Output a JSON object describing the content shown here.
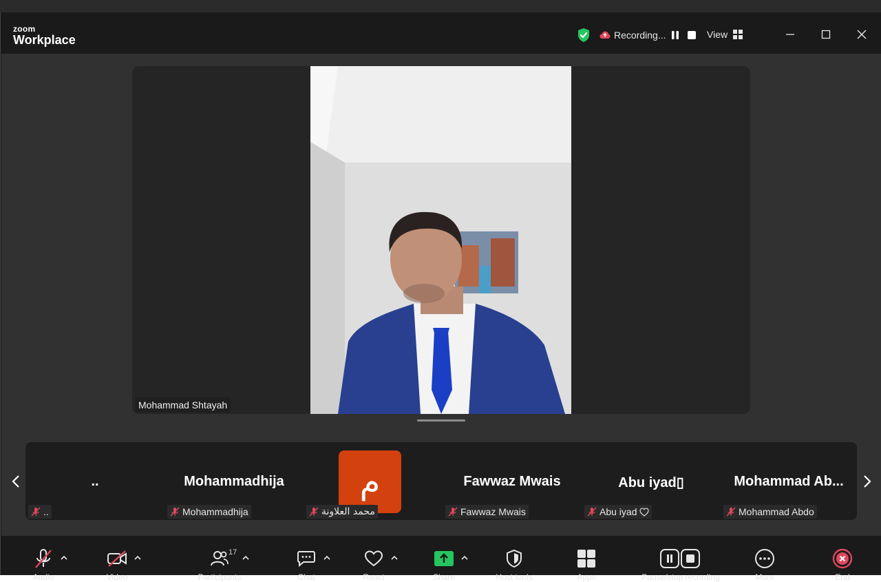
{
  "app": {
    "brand_top": "zoom",
    "brand_bottom": "Workplace"
  },
  "titlebar": {
    "recording_label": "Recording...",
    "view_label": "View"
  },
  "main_video": {
    "participant_name": "Mohammad Shtayah"
  },
  "gallery": {
    "tiles": [
      {
        "display": "..",
        "tag": ".."
      },
      {
        "display": "Mohammadhija",
        "tag": "Mohammadhija"
      },
      {
        "avatar_letter": "م",
        "tag": "محمد العلاونة"
      },
      {
        "display": "Fawwaz Mwais",
        "tag": "Fawwaz Mwais"
      },
      {
        "display": "Abu iyad▯",
        "tag": "Abu iyad"
      },
      {
        "display": "Mohammad Ab...",
        "tag": "Mohammad Abdo"
      }
    ]
  },
  "toolbar": {
    "audio_label": "Audio",
    "video_label": "Video",
    "participants_label": "Participants",
    "participants_count": "17",
    "chat_label": "Chat",
    "react_label": "React",
    "share_label": "Share",
    "host_tools_label": "Host tools",
    "view_label": "Apps",
    "recording_label": "Pause/stop recording",
    "more_label": "More",
    "end_label": "End"
  },
  "colors": {
    "accent_green": "#23c65f",
    "muted_red": "#e0475c",
    "avatar_orange": "#d2410e",
    "window_bg": "#1a1a1a",
    "content_bg": "#313131"
  }
}
